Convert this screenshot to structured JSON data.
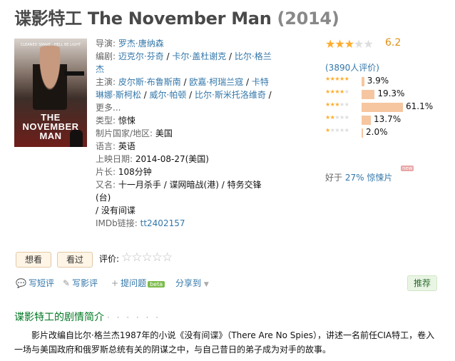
{
  "title": {
    "cn": "谍影特工",
    "en": "The November Man",
    "year": "(2014)"
  },
  "poster": {
    "tagline": "CLEANED SMART · HELL BE LIGHT",
    "title_line1": "THE NOVEMBER",
    "title_line2": "MAN"
  },
  "info": {
    "director_label": "导演:",
    "director": "罗杰·唐纳森",
    "writer_label": "编剧:",
    "writers": [
      "迈克尔·芬奇",
      "卡尔·盖杜谢克",
      "比尔·格兰杰"
    ],
    "cast_label": "主演:",
    "cast": [
      "皮尔斯·布鲁斯南",
      "欧嘉·柯瑞兰寇",
      "卡特琳娜·斯柯松",
      "威尔·帕顿",
      "比尔·斯米托洛维奇"
    ],
    "more": "更多...",
    "genre_label": "类型:",
    "genre": "惊悚",
    "country_label": "制片国家/地区:",
    "country": "美国",
    "language_label": "语言:",
    "language": "英语",
    "release_label": "上映日期:",
    "release": "2014-08-27(美国)",
    "runtime_label": "片长:",
    "runtime": "108分钟",
    "aka_label": "又名:",
    "aka_line1": "十一月杀手 / 谍网暗战(港) / 特务交锋(台)",
    "aka_line2": "/ 没有间谍",
    "imdb_label": "IMDb链接:",
    "imdb": "tt2402157"
  },
  "rating": {
    "score": "6.2",
    "stars_on": 3,
    "votes": "(3890人评价)",
    "distribution": [
      {
        "stars": 5,
        "percent": 3.9,
        "label": "3.9%"
      },
      {
        "stars": 4,
        "percent": 19.3,
        "label": "19.3%"
      },
      {
        "stars": 3,
        "percent": 61.1,
        "label": "61.1%"
      },
      {
        "stars": 2,
        "percent": 13.7,
        "label": "13.7%"
      },
      {
        "stars": 1,
        "percent": 2.0,
        "label": "2.0%"
      }
    ],
    "better_than_prefix": "好于",
    "better_than_value": "27%",
    "better_than_suffix": "惊悚片",
    "new_badge": "new"
  },
  "buttons": {
    "want": "想看",
    "seen": "看过",
    "rate_label": "评价:"
  },
  "actions": {
    "short_review": "写短评",
    "review": "写影评",
    "ask": "提问题",
    "beta": "beta",
    "share": "分享到",
    "share_arrow": "▼",
    "recommend": "推荐"
  },
  "summary": {
    "heading": "谍影特工的剧情简介",
    "dots": "· · · · · ·",
    "text": "影片改编自比尔·格兰杰1987年的小说《没有间谍》（There Are No Spies），讲述一名前任CIA特工，卷入一场与美国政府和俄罗斯总统有关的阴谋之中，与自己昔日的弟子成为对手的故事。"
  }
}
